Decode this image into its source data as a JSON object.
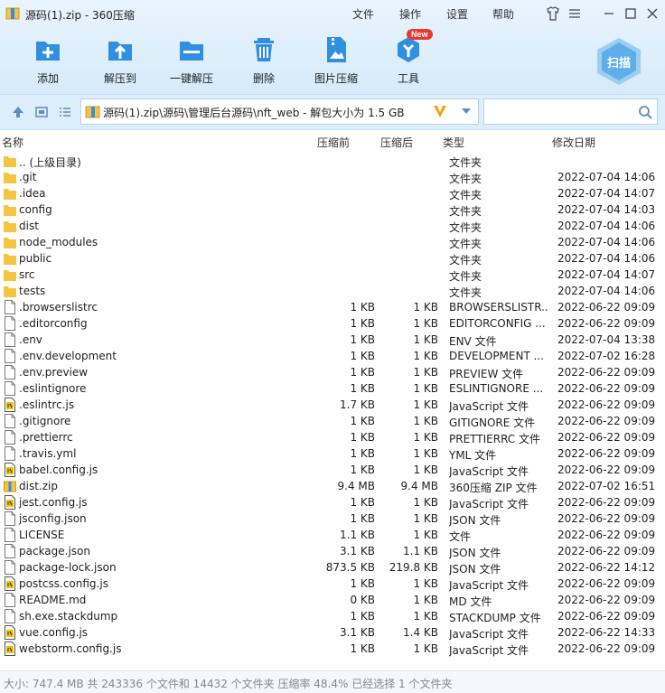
{
  "window": {
    "title": "源码(1).zip - 360压缩",
    "menus": [
      "文件",
      "操作",
      "设置",
      "帮助"
    ]
  },
  "toolbar": {
    "items": [
      {
        "label": "添加",
        "icon": "add-icon"
      },
      {
        "label": "解压到",
        "icon": "extract-to-icon"
      },
      {
        "label": "一键解压",
        "icon": "one-click-extract-icon"
      },
      {
        "label": "删除",
        "icon": "delete-icon"
      },
      {
        "label": "图片压缩",
        "icon": "image-compress-icon"
      },
      {
        "label": "工具",
        "icon": "tools-icon",
        "badge": "New"
      }
    ],
    "scan_label": "扫描"
  },
  "address": {
    "path": "源码(1).zip\\源码\\管理后台源码\\nft_web - 解包大小为 1.5 GB",
    "search_placeholder": ""
  },
  "columns": {
    "name": "名称",
    "size": "压缩前",
    "packed": "压缩后",
    "type": "类型",
    "modified": "修改日期"
  },
  "files": [
    {
      "name": ".. (上级目录)",
      "size": "",
      "packed": "",
      "type": "文件夹",
      "date": "",
      "kind": "folder"
    },
    {
      "name": ".git",
      "size": "",
      "packed": "",
      "type": "文件夹",
      "date": "2022-07-04 14:06",
      "kind": "folder"
    },
    {
      "name": ".idea",
      "size": "",
      "packed": "",
      "type": "文件夹",
      "date": "2022-07-04 14:07",
      "kind": "folder"
    },
    {
      "name": "config",
      "size": "",
      "packed": "",
      "type": "文件夹",
      "date": "2022-07-04 14:03",
      "kind": "folder"
    },
    {
      "name": "dist",
      "size": "",
      "packed": "",
      "type": "文件夹",
      "date": "2022-07-04 14:06",
      "kind": "folder"
    },
    {
      "name": "node_modules",
      "size": "",
      "packed": "",
      "type": "文件夹",
      "date": "2022-07-04 14:06",
      "kind": "folder"
    },
    {
      "name": "public",
      "size": "",
      "packed": "",
      "type": "文件夹",
      "date": "2022-07-04 14:06",
      "kind": "folder"
    },
    {
      "name": "src",
      "size": "",
      "packed": "",
      "type": "文件夹",
      "date": "2022-07-04 14:07",
      "kind": "folder"
    },
    {
      "name": "tests",
      "size": "",
      "packed": "",
      "type": "文件夹",
      "date": "2022-07-04 14:06",
      "kind": "folder"
    },
    {
      "name": ".browserslistrc",
      "size": "1 KB",
      "packed": "1 KB",
      "type": "BROWSERSLISTR...",
      "date": "2022-06-22 09:09",
      "kind": "file"
    },
    {
      "name": ".editorconfig",
      "size": "1 KB",
      "packed": "1 KB",
      "type": "EDITORCONFIG ...",
      "date": "2022-06-22 09:09",
      "kind": "file"
    },
    {
      "name": ".env",
      "size": "1 KB",
      "packed": "1 KB",
      "type": "ENV 文件",
      "date": "2022-07-04 13:38",
      "kind": "file"
    },
    {
      "name": ".env.development",
      "size": "1 KB",
      "packed": "1 KB",
      "type": "DEVELOPMENT ...",
      "date": "2022-07-02 16:28",
      "kind": "file"
    },
    {
      "name": ".env.preview",
      "size": "1 KB",
      "packed": "1 KB",
      "type": "PREVIEW 文件",
      "date": "2022-06-22 09:09",
      "kind": "file"
    },
    {
      "name": ".eslintignore",
      "size": "1 KB",
      "packed": "1 KB",
      "type": "ESLINTIGNORE ...",
      "date": "2022-06-22 09:09",
      "kind": "file"
    },
    {
      "name": ".eslintrc.js",
      "size": "1.7 KB",
      "packed": "1 KB",
      "type": "JavaScript 文件",
      "date": "2022-06-22 09:09",
      "kind": "js"
    },
    {
      "name": ".gitignore",
      "size": "1 KB",
      "packed": "1 KB",
      "type": "GITIGNORE 文件",
      "date": "2022-06-22 09:09",
      "kind": "file"
    },
    {
      "name": ".prettierrc",
      "size": "1 KB",
      "packed": "1 KB",
      "type": "PRETTIERRC 文件",
      "date": "2022-06-22 09:09",
      "kind": "file"
    },
    {
      "name": ".travis.yml",
      "size": "1 KB",
      "packed": "1 KB",
      "type": "YML 文件",
      "date": "2022-06-22 09:09",
      "kind": "file"
    },
    {
      "name": "babel.config.js",
      "size": "1 KB",
      "packed": "1 KB",
      "type": "JavaScript 文件",
      "date": "2022-06-22 09:09",
      "kind": "js"
    },
    {
      "name": "dist.zip",
      "size": "9.4 MB",
      "packed": "9.4 MB",
      "type": "360压缩 ZIP 文件",
      "date": "2022-07-02 16:51",
      "kind": "zip"
    },
    {
      "name": "jest.config.js",
      "size": "1 KB",
      "packed": "1 KB",
      "type": "JavaScript 文件",
      "date": "2022-06-22 09:09",
      "kind": "js"
    },
    {
      "name": "jsconfig.json",
      "size": "1 KB",
      "packed": "1 KB",
      "type": "JSON 文件",
      "date": "2022-06-22 09:09",
      "kind": "file"
    },
    {
      "name": "LICENSE",
      "size": "1.1 KB",
      "packed": "1 KB",
      "type": "文件",
      "date": "2022-06-22 09:09",
      "kind": "file"
    },
    {
      "name": "package.json",
      "size": "3.1 KB",
      "packed": "1.1 KB",
      "type": "JSON 文件",
      "date": "2022-06-22 09:09",
      "kind": "file"
    },
    {
      "name": "package-lock.json",
      "size": "873.5 KB",
      "packed": "219.8 KB",
      "type": "JSON 文件",
      "date": "2022-06-22 14:12",
      "kind": "file"
    },
    {
      "name": "postcss.config.js",
      "size": "1 KB",
      "packed": "1 KB",
      "type": "JavaScript 文件",
      "date": "2022-06-22 09:09",
      "kind": "js"
    },
    {
      "name": "README.md",
      "size": "0 KB",
      "packed": "1 KB",
      "type": "MD 文件",
      "date": "2022-06-22 09:09",
      "kind": "file"
    },
    {
      "name": "sh.exe.stackdump",
      "size": "1 KB",
      "packed": "1 KB",
      "type": "STACKDUMP 文件",
      "date": "2022-06-22 09:09",
      "kind": "file"
    },
    {
      "name": "vue.config.js",
      "size": "3.1 KB",
      "packed": "1.4 KB",
      "type": "JavaScript 文件",
      "date": "2022-06-22 14:33",
      "kind": "js"
    },
    {
      "name": "webstorm.config.js",
      "size": "1 KB",
      "packed": "1 KB",
      "type": "JavaScript 文件",
      "date": "2022-06-22 09:09",
      "kind": "js"
    }
  ],
  "status": "大小: 747.4 MB 共 243336 个文件和 14432 个文件夹 压缩率 48.4% 已经选择 1 个文件夹",
  "colors": {
    "accent": "#2f8fe0",
    "folder": "#f5c542",
    "toolbar_bg": "#d6eafa"
  }
}
